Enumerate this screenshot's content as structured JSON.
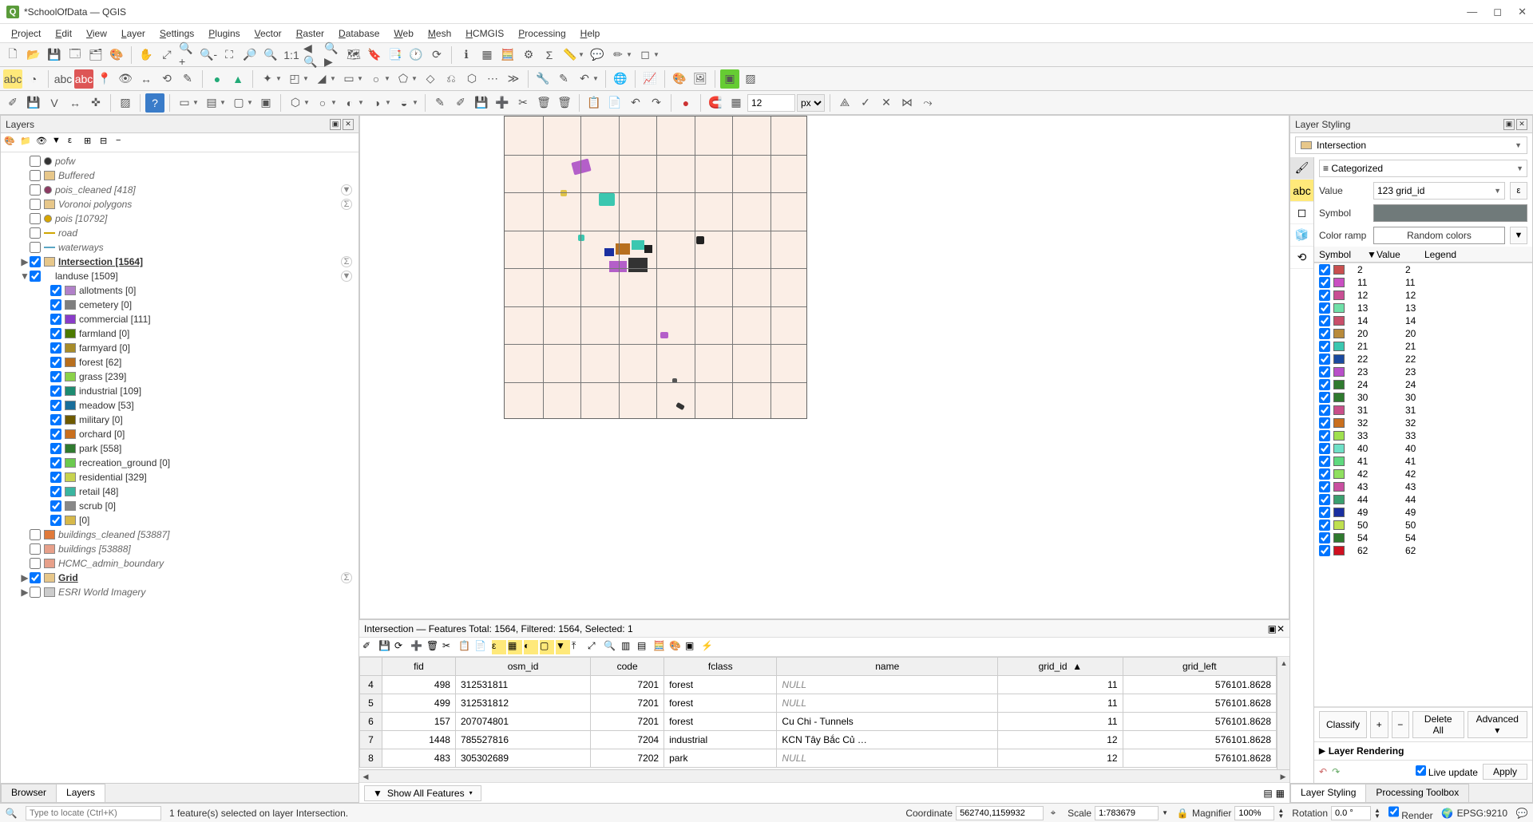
{
  "window": {
    "title": "*SchoolOfData — QGIS"
  },
  "menubar": [
    "Project",
    "Edit",
    "View",
    "Layer",
    "Settings",
    "Plugins",
    "Vector",
    "Raster",
    "Database",
    "Web",
    "Mesh",
    "HCMGIS",
    "Processing",
    "Help"
  ],
  "toolbar_opts": {
    "num_value": "12",
    "unit": "px"
  },
  "layers_panel": {
    "title": "Layers",
    "items": [
      {
        "type": "layer",
        "checked": false,
        "italic": true,
        "label": "pofw",
        "sym": "#333",
        "symType": "dot"
      },
      {
        "type": "layer",
        "checked": false,
        "italic": true,
        "label": "Buffered",
        "sym": "#e7c78a"
      },
      {
        "type": "layer",
        "checked": false,
        "italic": true,
        "label": "pois_cleaned [418]",
        "sym": "#8b3a62",
        "symType": "dot",
        "actions": [
          "filter"
        ]
      },
      {
        "type": "layer",
        "checked": false,
        "italic": true,
        "label": "Voronoi polygons",
        "sym": "#e7c78a",
        "actions": [
          "count"
        ]
      },
      {
        "type": "layer",
        "checked": false,
        "italic": true,
        "label": "pois [10792]",
        "sym": "#d6a500",
        "symType": "dot"
      },
      {
        "type": "layer",
        "checked": false,
        "italic": true,
        "label": "road",
        "sym": "#cfa500",
        "symType": "line"
      },
      {
        "type": "layer",
        "checked": false,
        "italic": true,
        "label": "waterways",
        "sym": "#5aa6c4",
        "symType": "line"
      },
      {
        "type": "layer",
        "checked": true,
        "bold": true,
        "label": "Intersection [1564]",
        "sym": "#e7c78a",
        "expand": "▶",
        "actions": [
          "count"
        ]
      },
      {
        "type": "group",
        "checked": true,
        "label": "landuse [1509]",
        "expand": "▼",
        "actions": [
          "filter"
        ]
      },
      {
        "type": "child",
        "checked": true,
        "label": "allotments [0]",
        "sym": "#b181c9"
      },
      {
        "type": "child",
        "checked": true,
        "label": "cemetery [0]",
        "sym": "#7f7f7f"
      },
      {
        "type": "child",
        "checked": true,
        "label": "commercial [111]",
        "sym": "#8a3cc9"
      },
      {
        "type": "child",
        "checked": true,
        "label": "farmland [0]",
        "sym": "#4c7a00"
      },
      {
        "type": "child",
        "checked": true,
        "label": "farmyard [0]",
        "sym": "#a78c2a"
      },
      {
        "type": "child",
        "checked": true,
        "label": "forest [62]",
        "sym": "#b86f1e"
      },
      {
        "type": "child",
        "checked": true,
        "label": "grass [239]",
        "sym": "#8bd24a"
      },
      {
        "type": "child",
        "checked": true,
        "label": "industrial [109]",
        "sym": "#1e8b71"
      },
      {
        "type": "child",
        "checked": true,
        "label": "meadow [53]",
        "sym": "#1a6e9a"
      },
      {
        "type": "child",
        "checked": true,
        "label": "military [0]",
        "sym": "#6e5a00"
      },
      {
        "type": "child",
        "checked": true,
        "label": "orchard [0]",
        "sym": "#c96f1e"
      },
      {
        "type": "child",
        "checked": true,
        "label": "park [558]",
        "sym": "#2f7a2f"
      },
      {
        "type": "child",
        "checked": true,
        "label": "recreation_ground [0]",
        "sym": "#6bc94f"
      },
      {
        "type": "child",
        "checked": true,
        "label": "residential [329]",
        "sym": "#c7d34f"
      },
      {
        "type": "child",
        "checked": true,
        "label": "retail [48]",
        "sym": "#3bb5a0"
      },
      {
        "type": "child",
        "checked": true,
        "label": "scrub [0]",
        "sym": "#888"
      },
      {
        "type": "child",
        "checked": true,
        "label": " [0]",
        "sym": "#d6b84a"
      },
      {
        "type": "layer",
        "checked": false,
        "italic": true,
        "label": "buildings_cleaned [53887]",
        "sym": "#e07a3a"
      },
      {
        "type": "layer",
        "checked": false,
        "italic": true,
        "label": "buildings [53888]",
        "sym": "#e7a08a"
      },
      {
        "type": "layer",
        "checked": false,
        "italic": true,
        "label": "HCMC_admin_boundary",
        "sym": "#e7a08a"
      },
      {
        "type": "layer",
        "checked": true,
        "bold": true,
        "label": "Grid",
        "sym": "#e7c78a",
        "expand": "▶",
        "actions": [
          "count"
        ]
      },
      {
        "type": "layer",
        "checked": false,
        "italic": true,
        "label": "ESRI World Imagery",
        "sym": "#ccc",
        "expand": "▶"
      }
    ],
    "bottom_tabs": [
      "Browser",
      "Layers"
    ]
  },
  "attr_table": {
    "title": "Intersection — Features Total: 1564, Filtered: 1564, Selected: 1",
    "columns": [
      "fid",
      "osm_id",
      "code",
      "fclass",
      "name",
      "grid_id",
      "grid_left"
    ],
    "sort_col": "grid_id",
    "rows": [
      {
        "rh": "4",
        "fid": "498",
        "osm_id": "312531811",
        "code": "7201",
        "fclass": "forest",
        "name": null,
        "grid_id": "11",
        "grid_left": "576101.8628"
      },
      {
        "rh": "5",
        "fid": "499",
        "osm_id": "312531812",
        "code": "7201",
        "fclass": "forest",
        "name": null,
        "grid_id": "11",
        "grid_left": "576101.8628"
      },
      {
        "rh": "6",
        "fid": "157",
        "osm_id": "207074801",
        "code": "7201",
        "fclass": "forest",
        "name": "Cu Chi - Tunnels",
        "grid_id": "11",
        "grid_left": "576101.8628"
      },
      {
        "rh": "7",
        "fid": "1448",
        "osm_id": "785527816",
        "code": "7204",
        "fclass": "industrial",
        "name": "KCN Tây Bắc Củ …",
        "grid_id": "12",
        "grid_left": "576101.8628"
      },
      {
        "rh": "8",
        "fid": "483",
        "osm_id": "305302689",
        "code": "7202",
        "fclass": "park",
        "name": null,
        "grid_id": "12",
        "grid_left": "576101.8628"
      }
    ],
    "show_all": "Show All Features"
  },
  "styling": {
    "title": "Layer Styling",
    "layer_selected": "Intersection",
    "renderer": "Categorized",
    "value_label": "Value",
    "value_field": "123 grid_id",
    "symbol_label": "Symbol",
    "colorramp_label": "Color ramp",
    "colorramp": "Random colors",
    "list_head": {
      "sym": "Symbol",
      "val": "Value",
      "leg": "Legend"
    },
    "categories": [
      {
        "val": "2",
        "leg": "2",
        "color": "#c94f4f"
      },
      {
        "val": "11",
        "leg": "11",
        "color": "#c94fc2"
      },
      {
        "val": "12",
        "leg": "12",
        "color": "#c94f94"
      },
      {
        "val": "13",
        "leg": "13",
        "color": "#6fe0a8"
      },
      {
        "val": "14",
        "leg": "14",
        "color": "#c94f6a"
      },
      {
        "val": "20",
        "leg": "20",
        "color": "#b88a3a"
      },
      {
        "val": "21",
        "leg": "21",
        "color": "#3bc7b0"
      },
      {
        "val": "22",
        "leg": "22",
        "color": "#1a4aa0"
      },
      {
        "val": "23",
        "leg": "23",
        "color": "#b84fc9"
      },
      {
        "val": "24",
        "leg": "24",
        "color": "#2f7a2f"
      },
      {
        "val": "30",
        "leg": "30",
        "color": "#2f7a2f"
      },
      {
        "val": "31",
        "leg": "31",
        "color": "#c94f8a"
      },
      {
        "val": "32",
        "leg": "32",
        "color": "#c96f1e"
      },
      {
        "val": "33",
        "leg": "33",
        "color": "#9fe04f"
      },
      {
        "val": "40",
        "leg": "40",
        "color": "#6fe0c7"
      },
      {
        "val": "41",
        "leg": "41",
        "color": "#5fd97f"
      },
      {
        "val": "42",
        "leg": "42",
        "color": "#8fe05f"
      },
      {
        "val": "43",
        "leg": "43",
        "color": "#c94fa0"
      },
      {
        "val": "44",
        "leg": "44",
        "color": "#3aa06f"
      },
      {
        "val": "49",
        "leg": "49",
        "color": "#1a2fa0"
      },
      {
        "val": "50",
        "leg": "50",
        "color": "#bfe04f"
      },
      {
        "val": "54",
        "leg": "54",
        "color": "#2f7a2f"
      },
      {
        "val": "62",
        "leg": "62",
        "color": "#c01e"
      }
    ],
    "buttons": {
      "classify": "Classify",
      "add": "+",
      "del": "−",
      "delall": "Delete All",
      "adv": "Advanced"
    },
    "layer_rendering": "Layer Rendering",
    "live_update": "Live update",
    "apply": "Apply",
    "bottom_tabs": [
      "Layer Styling",
      "Processing Toolbox"
    ]
  },
  "statusbar": {
    "locate_placeholder": "Type to locate (Ctrl+K)",
    "message": "1 feature(s) selected on layer Intersection.",
    "coord_label": "Coordinate",
    "coord": "562740,1159932",
    "scale_label": "Scale",
    "scale": "1:783679",
    "magnifier_label": "Magnifier",
    "magnifier": "100%",
    "rotation_label": "Rotation",
    "rotation": "0.0 °",
    "render": "Render",
    "crs": "EPSG:9210"
  },
  "null_text": "NULL"
}
